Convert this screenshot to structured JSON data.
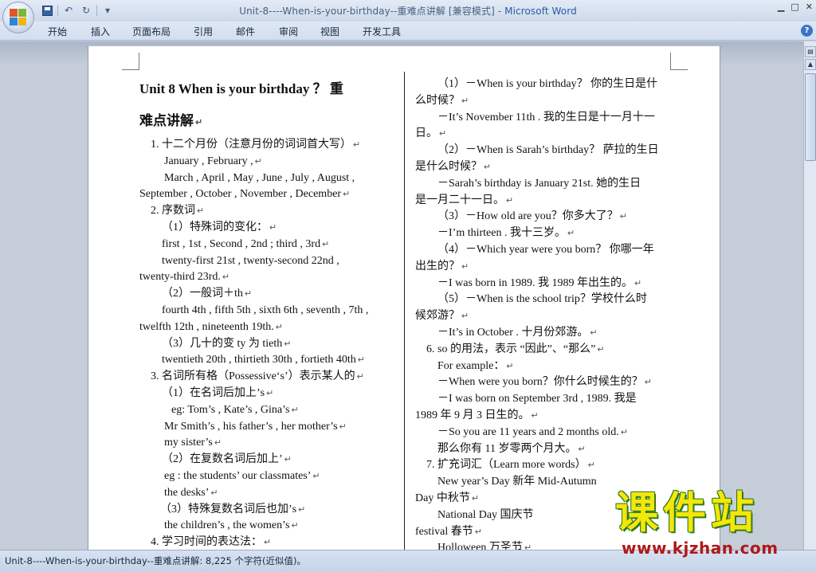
{
  "window": {
    "title": "Unit-8----When-is-your-birthday--重难点讲解 [兼容模式]",
    "title_sep": " - ",
    "app_name": "Microsoft Word",
    "min_symbol": "▁",
    "max_symbol": "□",
    "close_symbol": "✕"
  },
  "quick_access": {
    "undo_symbol": "↶",
    "redo_symbol": "↻",
    "dropdown_symbol": "▾"
  },
  "ribbon": {
    "tabs": [
      "开始",
      "插入",
      "页面布局",
      "引用",
      "邮件",
      "审阅",
      "视图",
      "开发工具"
    ],
    "help_symbol": "?"
  },
  "document": {
    "paragraph_mark": "↵",
    "left_column": [
      {
        "text": "Unit 8        When  is  your  birthday ？ 重",
        "style": "h1"
      },
      {
        "text": "难点讲解",
        "style": "h1b",
        "mark": true
      },
      {
        "text": "1. 十二个月份（注意月份的词词首大写）",
        "style": "ind1",
        "mark": true
      },
      {
        "text": "January , February ,",
        "style": "ind25",
        "mark": true
      },
      {
        "text": "March , April , May , June , July , August ,",
        "style": "ind25"
      },
      {
        "text": "September , October , November , December",
        "style": "",
        "mark": true
      },
      {
        "text": "2. 序数词",
        "style": "ind1",
        "mark": true
      },
      {
        "text": "（1）特殊词的变化：",
        "style": "ind2",
        "mark": true
      },
      {
        "text": "first , 1st , Second , 2nd ; third , 3rd",
        "style": "ind2",
        "mark": true
      },
      {
        "text": "twenty-first   21st   ,   twenty-second   22nd   ,",
        "style": "ind2"
      },
      {
        "text": "twenty-third 23rd.",
        "style": "",
        "mark": true
      },
      {
        "text": "（2）一般词＋th",
        "style": "ind2",
        "mark": true
      },
      {
        "text": "fourth 4th , fifth 5th , sixth 6th , seventh , 7th ,",
        "style": "ind2"
      },
      {
        "text": "twelfth 12th , nineteenth 19th.",
        "style": "",
        "mark": true
      },
      {
        "text": "（3）几十的变 ty 为 tieth",
        "style": "ind2",
        "mark": true
      },
      {
        "text": "twentieth 20th , thirtieth 30th , fortieth 40th",
        "style": "ind2",
        "mark": true
      },
      {
        "text": "3. 名词所有格（Possessive‘s’）表示某人的",
        "style": "ind1",
        "mark": true
      },
      {
        "text": "（1）在名词后加上’s",
        "style": "ind2",
        "mark": true
      },
      {
        "text": "eg: Tom’s , Kate’s , Gina’s",
        "style": "ind3",
        "mark": true
      },
      {
        "text": "Mr Smith’s , his father’s , her mother’s",
        "style": "ind25",
        "mark": true
      },
      {
        "text": "my sister’s",
        "style": "ind25",
        "mark": true
      },
      {
        "text": "（2）在复数名词后加上’",
        "style": "ind2",
        "mark": true
      },
      {
        "text": "eg : the students’             our classmates’",
        "style": "ind25",
        "mark": true
      },
      {
        "text": "the desks’",
        "style": "ind25",
        "mark": true
      },
      {
        "text": "（3）特殊复数名词后也加’s",
        "style": "ind1b",
        "mark": true
      },
      {
        "text": "the children’s , the women’s",
        "style": "ind25",
        "mark": true
      },
      {
        "text": "4. 学习时间的表达法：",
        "style": "ind1",
        "mark": true
      }
    ],
    "right_column": [
      {
        "text": "（1）－When is your birthday？ 你的生日是什",
        "style": "ind2"
      },
      {
        "text": "么时候？",
        "style": "",
        "mark": true
      },
      {
        "text": "－It’s November 11th . 我的生日是十一月十一",
        "style": "ind2"
      },
      {
        "text": "日。",
        "style": "",
        "mark": true
      },
      {
        "text": "（2）－When is Sarah’s birthday？ 萨拉的生日",
        "style": "ind2"
      },
      {
        "text": "是什么时候？",
        "style": "",
        "mark": true
      },
      {
        "text": "－Sarah’s birthday is January 21st. 她的生日",
        "style": "ind2"
      },
      {
        "text": "是一月二十一日。",
        "style": "",
        "mark": true
      },
      {
        "text": "（3）－How old are you？你多大了？",
        "style": "ind2",
        "mark": true
      },
      {
        "text": "－I’m thirteen . 我十三岁。",
        "style": "ind2",
        "mark": true
      },
      {
        "text": "（4）－Which year were you born？ 你哪一年",
        "style": "ind2"
      },
      {
        "text": "出生的？",
        "style": "",
        "mark": true
      },
      {
        "text": "－I was born in 1989. 我 1989 年出生的。",
        "style": "ind2",
        "mark": true
      },
      {
        "text": "（5）－When is the school trip？学校什么时",
        "style": "ind2"
      },
      {
        "text": "候郊游？",
        "style": "",
        "mark": true
      },
      {
        "text": "－It’s in October . 十月份郊游。",
        "style": "ind2",
        "mark": true
      },
      {
        "text": "6. so 的用法，表示 “因此”、“那么”",
        "style": "ind1",
        "mark": true
      },
      {
        "text": "For example：",
        "style": "ind2",
        "mark": true
      },
      {
        "text": "－When were you born？你什么时候生的？",
        "style": "ind2",
        "mark": true
      },
      {
        "text": "－I  was  born  on  September  3rd  ,  1989.  我是",
        "style": "ind2"
      },
      {
        "text": "1989 年 9 月 3 日生的。",
        "style": "",
        "mark": true
      },
      {
        "text": "－So you are 11 years and 2 months old.",
        "style": "ind2",
        "mark": true
      },
      {
        "text": "那么你有 11 岁零两个月大。",
        "style": "ind2",
        "mark": true
      },
      {
        "text": "7. 扩充词汇（Learn more words）",
        "style": "ind1",
        "mark": true
      },
      {
        "text": "New year’s Day    新年             Mid-Autumn",
        "style": "ind2"
      },
      {
        "text": "Day 中秋节",
        "style": "",
        "mark": true
      },
      {
        "text": "National Day  国庆节",
        "style": "ind2"
      },
      {
        "text": "festival  春节",
        "style": "",
        "mark": true
      },
      {
        "text": "Holloween 万圣节",
        "style": "ind2",
        "mark": true
      }
    ]
  },
  "status": {
    "text": "Unit-8----When-is-your-birthday--重难点讲解: 8,225 个字符(近似值)。"
  },
  "watermark": {
    "big": "课件站",
    "url": "www.kjzhan.com"
  }
}
